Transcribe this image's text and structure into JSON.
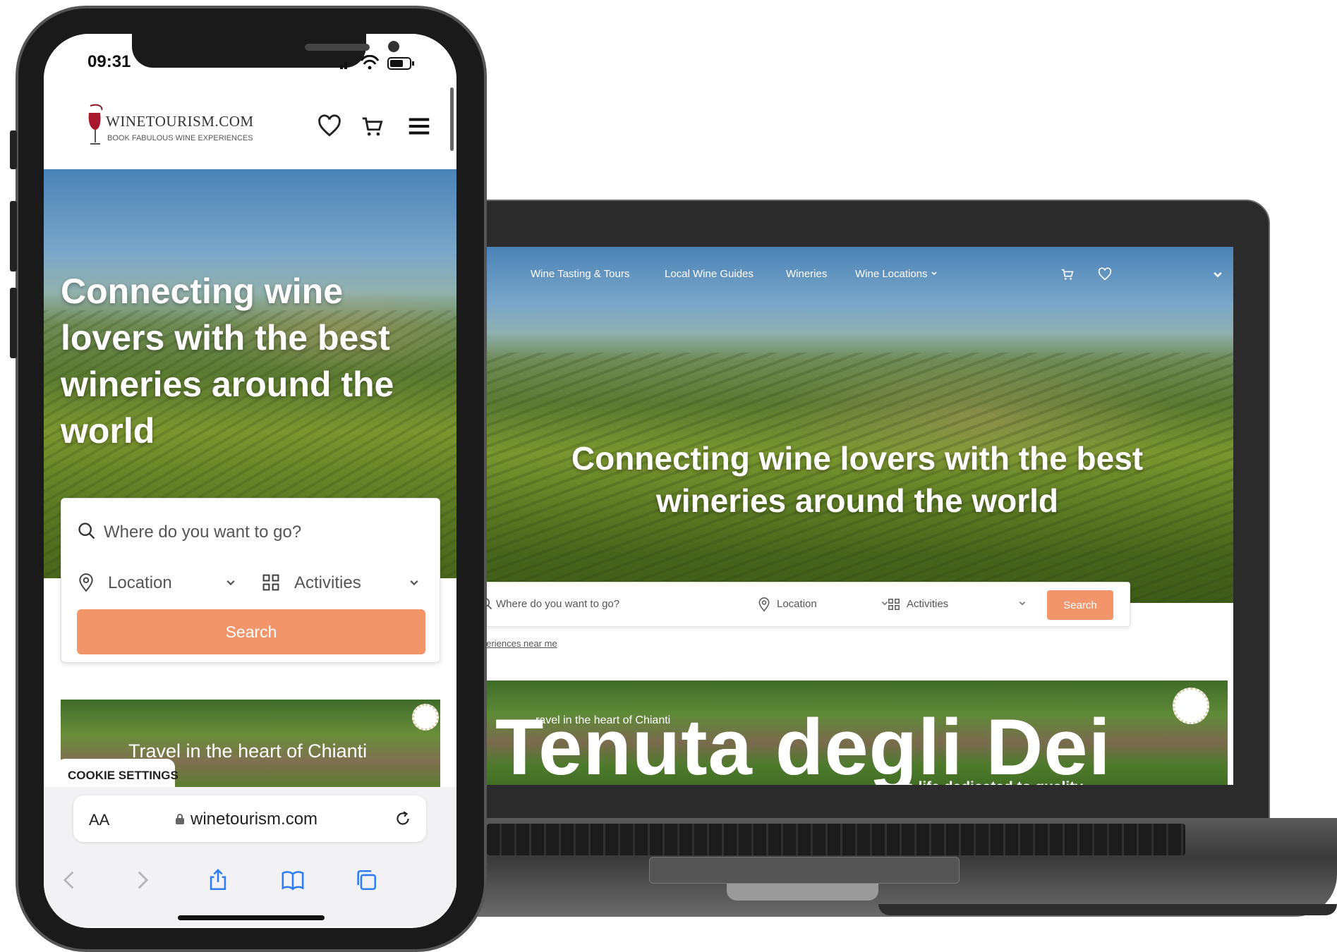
{
  "colors": {
    "accent": "#f3956a",
    "text_dark": "#222222",
    "text_muted": "#555555",
    "white": "#ffffff",
    "device_frame": "#1a1a1a"
  },
  "mobile": {
    "status_bar": {
      "time": "09:31"
    },
    "header": {
      "logo_name": "WINETOURISM.COM",
      "logo_tagline": "BOOK FABULOUS WINE EXPERIENCES",
      "icons": [
        "heart-icon",
        "cart-icon",
        "hamburger-menu-icon"
      ]
    },
    "hero": {
      "title": "Connecting wine lovers with the best wineries around the world"
    },
    "search": {
      "placeholder": "Where do you want to go?",
      "location_label": "Location",
      "activities_label": "Activities",
      "button_label": "Search"
    },
    "featured_card": {
      "text": "Travel in the heart of Chianti"
    },
    "cookie_settings_label": "COOKIE SETTINGS",
    "browser": {
      "text_size_label": "AA",
      "url": "winetourism.com",
      "toolbar_icons": [
        "back-icon",
        "forward-icon",
        "share-icon",
        "bookmarks-icon",
        "tabs-icon"
      ]
    }
  },
  "desktop": {
    "nav": {
      "items": [
        {
          "label": "Wine Tasting & Tours"
        },
        {
          "label": "Local Wine Guides"
        },
        {
          "label": "Wineries"
        },
        {
          "label": "Wine Locations"
        }
      ],
      "icons": [
        "cart-icon",
        "heart-icon",
        "chevron-down-icon"
      ]
    },
    "hero": {
      "title": "Connecting wine lovers with the best wineries around the world"
    },
    "search": {
      "placeholder": "Where do you want to go?",
      "location_label": "Location",
      "activities_label": "Activities",
      "button_label": "Search",
      "near_me_link": "periences near me"
    },
    "banner": {
      "subtitle": "ravel in the heart of Chianti",
      "title": "Tenuta degli Dei",
      "tagline": "a life dedicated to quality"
    }
  }
}
